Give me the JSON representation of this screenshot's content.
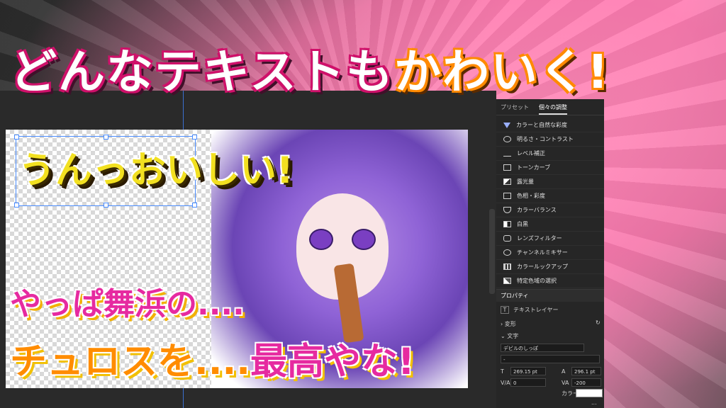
{
  "headline": {
    "part1": "どんなテキストも",
    "part2": "かわいく!"
  },
  "canvas_texts": {
    "line1": "うんっおいしい!",
    "line2": "やっぱ舞浜の....",
    "line3a": "チュロスを....",
    "line3b": "最高やな!"
  },
  "adjust_panel": {
    "tabs": [
      "プリセット",
      "個々の調整"
    ],
    "items": [
      {
        "label": "カラーと自然な彩度",
        "icon": "vibrance-icon"
      },
      {
        "label": "明るさ・コントラスト",
        "icon": "brightness-icon"
      },
      {
        "label": "レベル補正",
        "icon": "levels-icon"
      },
      {
        "label": "トーンカーブ",
        "icon": "curves-icon"
      },
      {
        "label": "露光量",
        "icon": "exposure-icon"
      },
      {
        "label": "色相・彩度",
        "icon": "hue-saturation-icon"
      },
      {
        "label": "カラーバランス",
        "icon": "color-balance-icon"
      },
      {
        "label": "白黒",
        "icon": "black-white-icon"
      },
      {
        "label": "レンズフィルター",
        "icon": "photo-filter-icon"
      },
      {
        "label": "チャンネルミキサー",
        "icon": "channel-mixer-icon"
      },
      {
        "label": "カラールックアップ",
        "icon": "color-lookup-icon"
      },
      {
        "label": "特定色域の選択",
        "icon": "selective-color-icon"
      }
    ]
  },
  "properties": {
    "title": "プロパティ",
    "layer_type": "テキストレイヤー",
    "transform": "変形",
    "character": "文字",
    "font": "デビルのしっぽ",
    "style": "-",
    "size": "269.15 pt",
    "leading": "296.1 pt",
    "kerning": "0",
    "tracking": "-200",
    "color_label": "カラー:",
    "more": "..."
  },
  "colors": {
    "accent_pink": "#e62aa0",
    "accent_orange": "#ff8c00",
    "selection": "#4a8cff",
    "text_color": "#ffffff"
  }
}
